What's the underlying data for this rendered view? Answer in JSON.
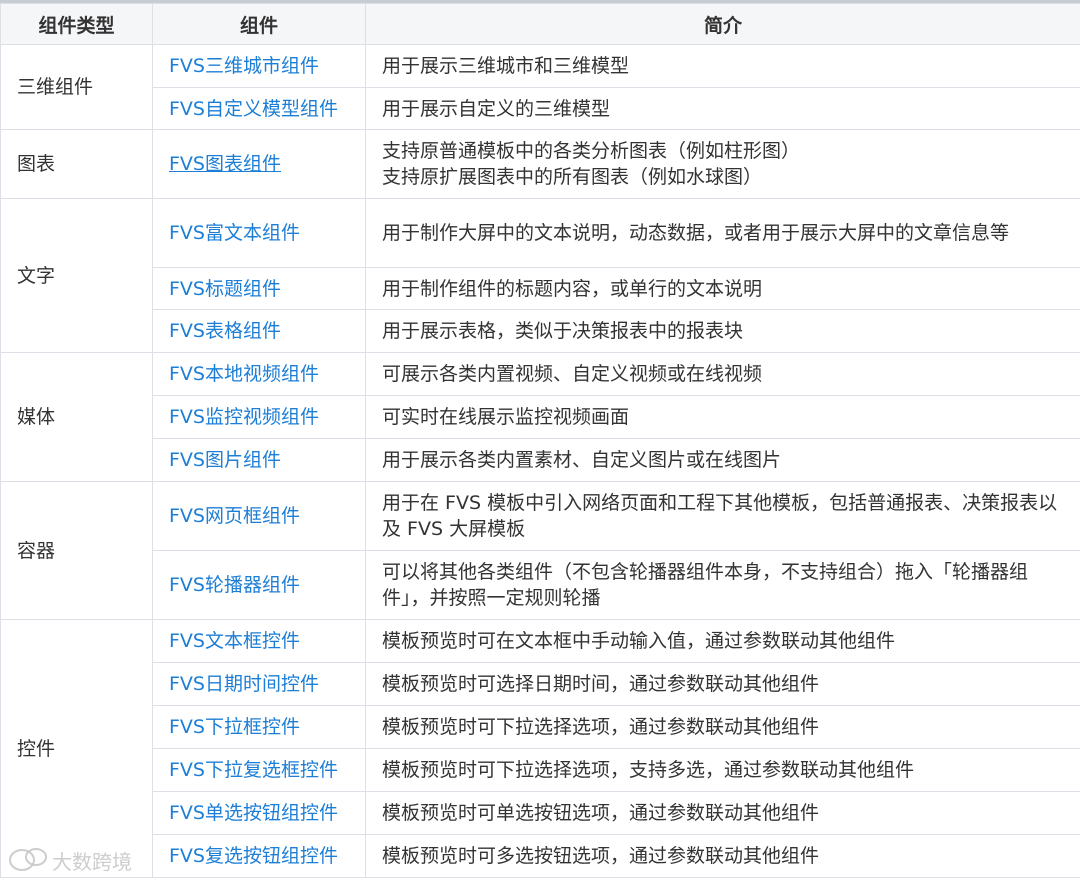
{
  "headers": [
    "组件类型",
    "组件",
    "简介"
  ],
  "groups": [
    {
      "type": "三维组件",
      "rows": [
        {
          "component": "FVS三维城市组件",
          "desc": "用于展示三维城市和三维模型"
        },
        {
          "component": "FVS自定义模型组件",
          "desc": "用于展示自定义的三维模型"
        }
      ]
    },
    {
      "type": "图表",
      "rows": [
        {
          "component": "FVS图表组件",
          "desc_lines": [
            "支持原普通模板中的各类分析图表（例如柱形图）",
            "支持原扩展图表中的所有图表（例如水球图）"
          ]
        }
      ]
    },
    {
      "type": "文字",
      "rows": [
        {
          "component": "FVS富文本组件",
          "desc": "用于制作大屏中的文本说明，动态数据，或者用于展示大屏中的文章信息等"
        },
        {
          "component": "FVS标题组件",
          "desc": "用于制作组件的标题内容，或单行的文本说明"
        },
        {
          "component": "FVS表格组件",
          "desc": "用于展示表格，类似于决策报表中的报表块"
        }
      ]
    },
    {
      "type": "媒体",
      "rows": [
        {
          "component": "FVS本地视频组件",
          "desc": "可展示各类内置视频、自定义视频或在线视频"
        },
        {
          "component": "FVS监控视频组件",
          "desc": "可实时在线展示监控视频画面"
        },
        {
          "component": "FVS图片组件",
          "desc": "用于展示各类内置素材、自定义图片或在线图片"
        }
      ]
    },
    {
      "type": "容器",
      "rows": [
        {
          "component": "FVS网页框组件",
          "desc": "用于在 FVS 模板中引入网络页面和工程下其他模板，包括普通报表、决策报表以及 FVS 大屏模板"
        },
        {
          "component": "FVS轮播器组件",
          "desc": "可以将其他各类组件（不包含轮播器组件本身，不支持组合）拖入「轮播器组件」，并按照一定规则轮播"
        }
      ]
    },
    {
      "type": "控件",
      "rows": [
        {
          "component": "FVS文本框控件",
          "desc": "模板预览时可在文本框中手动输入值，通过参数联动其他组件"
        },
        {
          "component": "FVS日期时间控件",
          "desc": "模板预览时可选择日期时间，通过参数联动其他组件"
        },
        {
          "component": "FVS下拉框控件",
          "desc": "模板预览时可下拉选择选项，通过参数联动其他组件"
        },
        {
          "component": "FVS下拉复选框控件",
          "desc": "模板预览时可下拉选择选项，支持多选，通过参数联动其他组件"
        },
        {
          "component": "FVS单选按钮组控件",
          "desc": "模板预览时可单选按钮选项，通过参数联动其他组件"
        },
        {
          "component": "FVS复选按钮组控件",
          "desc": "模板预览时可多选按钮选项，通过参数联动其他组件"
        }
      ]
    }
  ],
  "watermark": "大数跨境",
  "colors": {
    "link": "#1c7ed6",
    "header_bg": "#f5f6f8",
    "border": "#dcdfe6"
  }
}
